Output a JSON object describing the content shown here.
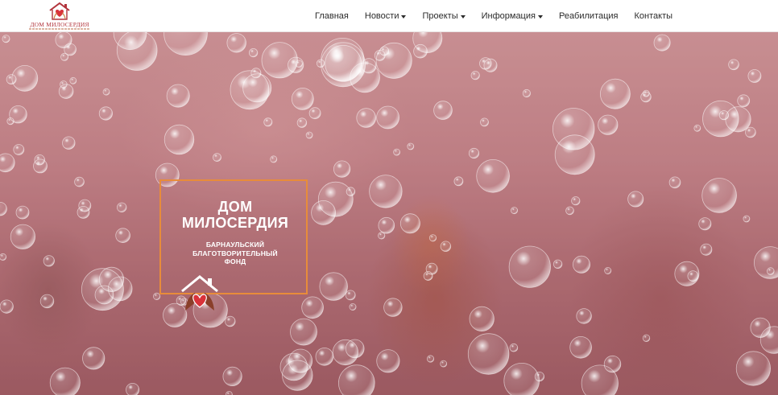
{
  "header": {
    "logo": {
      "name": "ДОМ МИЛОСЕРДИЯ",
      "icon": "house-heart-icon"
    },
    "nav": [
      {
        "label": "Главная",
        "has_dropdown": false
      },
      {
        "label": "Новости",
        "has_dropdown": true
      },
      {
        "label": "Проекты",
        "has_dropdown": true
      },
      {
        "label": "Информация",
        "has_dropdown": true
      },
      {
        "label": "Реабилитация",
        "has_dropdown": false
      },
      {
        "label": "Контакты",
        "has_dropdown": false
      }
    ]
  },
  "hero": {
    "title_line1": "ДОМ",
    "title_line2": "МИЛОСЕРДИЯ",
    "subtitle_line1": "БАРНАУЛЬСКИЙ",
    "subtitle_line2": "БЛАГОТВОРИТЕЛЬНЫЙ",
    "subtitle_line3": "ФОНД",
    "emblem": "house-heart-icon"
  },
  "colors": {
    "logo_red": "#b2343c",
    "card_border": "#e88c3a",
    "heart_red": "#d9323a",
    "hands_brown": "#8a3f2a"
  }
}
